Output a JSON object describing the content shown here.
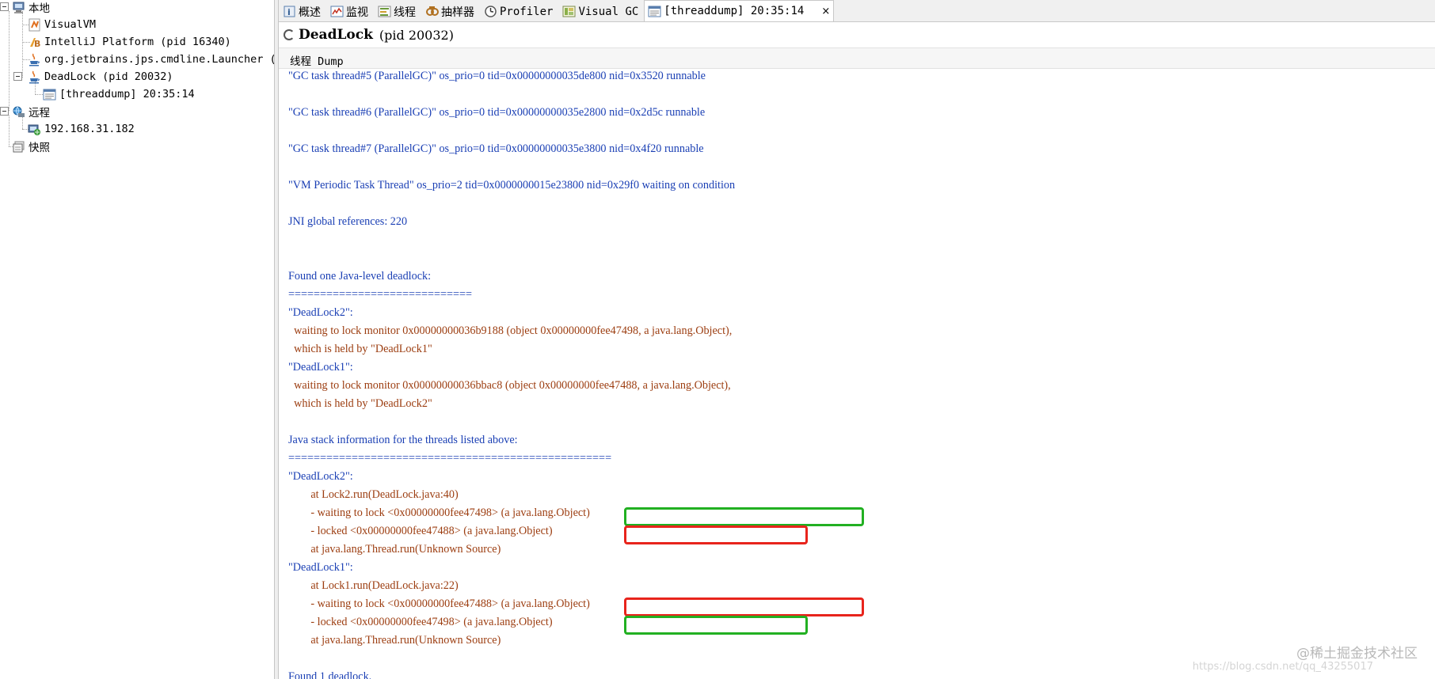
{
  "sidebar": {
    "items": [
      {
        "label": "本地",
        "icon": "computer-icon"
      },
      {
        "label": "VisualVM",
        "icon": "visualvm-icon"
      },
      {
        "label": "IntelliJ Platform (pid 16340)",
        "icon": "intellij-icon"
      },
      {
        "label": "org.jetbrains.jps.cmdline.Launcher (p",
        "icon": "java-cup-icon"
      },
      {
        "label": "DeadLock (pid 20032)",
        "icon": "java-cup-icon"
      },
      {
        "label": "[threaddump] 20:35:14",
        "icon": "threaddump-icon"
      },
      {
        "label": "远程",
        "icon": "remote-icon"
      },
      {
        "label": "192.168.31.182",
        "icon": "remote-host-icon"
      },
      {
        "label": "快照",
        "icon": "snapshot-icon"
      }
    ]
  },
  "tabs": [
    {
      "label": "概述",
      "icon": "overview-icon"
    },
    {
      "label": "监视",
      "icon": "monitor-icon"
    },
    {
      "label": "线程",
      "icon": "threads-icon"
    },
    {
      "label": "抽样器",
      "icon": "sampler-icon"
    },
    {
      "label": "Profiler",
      "icon": "profiler-icon"
    },
    {
      "label": "Visual GC",
      "icon": "visual-gc-icon"
    },
    {
      "label": "[threaddump] 20:35:14",
      "icon": "threaddump-icon",
      "active": true,
      "close": "×"
    }
  ],
  "header": {
    "title": "DeadLock",
    "pid": "(pid 20032)"
  },
  "subheader": {
    "label": "线程 Dump"
  },
  "dump": {
    "lines": [
      "\"GC task thread#5 (ParallelGC)\" os_prio=0 tid=0x00000000035de800 nid=0x3520 runnable",
      "",
      "\"GC task thread#6 (ParallelGC)\" os_prio=0 tid=0x00000000035e2800 nid=0x2d5c runnable",
      "",
      "\"GC task thread#7 (ParallelGC)\" os_prio=0 tid=0x00000000035e3800 nid=0x4f20 runnable",
      "",
      "\"VM Periodic Task Thread\" os_prio=2 tid=0x0000000015e23800 nid=0x29f0 waiting on condition",
      "",
      "JNI global references: 220",
      "",
      "",
      "Found one Java-level deadlock:",
      "=============================",
      "\"DeadLock2\":",
      "  waiting to lock monitor 0x00000000036b9188 (object 0x00000000fee47498, a java.lang.Object),",
      "  which is held by \"DeadLock1\"",
      "\"DeadLock1\":",
      "  waiting to lock monitor 0x00000000036bbac8 (object 0x00000000fee47488, a java.lang.Object),",
      "  which is held by \"DeadLock2\"",
      "",
      "Java stack information for the threads listed above:",
      "===================================================",
      "\"DeadLock2\":",
      "        at Lock2.run(DeadLock.java:40)",
      "        - waiting to lock <0x00000000fee47498> (a java.lang.Object)",
      "        - locked <0x00000000fee47488> (a java.lang.Object)",
      "        at java.lang.Thread.run(Unknown Source)",
      "\"DeadLock1\":",
      "        at Lock1.run(DeadLock.java:22)",
      "        - waiting to lock <0x00000000fee47488> (a java.lang.Object)",
      "        - locked <0x00000000fee47498> (a java.lang.Object)",
      "        at java.lang.Thread.run(Unknown Source)",
      "",
      "Found 1 deadlock."
    ],
    "colors": [
      "blue",
      "blue",
      "blue",
      "blue",
      "blue",
      "blue",
      "blue",
      "blue",
      "blue",
      "blue",
      "blue",
      "blue",
      "blue",
      "blue",
      "brown",
      "brown",
      "blue",
      "brown",
      "brown",
      "blue",
      "blue",
      "blue",
      "blue",
      "brown",
      "brown",
      "brown",
      "brown",
      "blue",
      "brown",
      "brown",
      "brown",
      "brown",
      "blue",
      "blue"
    ]
  },
  "watermark": {
    "text": "@稀土掘金技术社区",
    "url": "https://blog.csdn.net/qq_43255017"
  }
}
